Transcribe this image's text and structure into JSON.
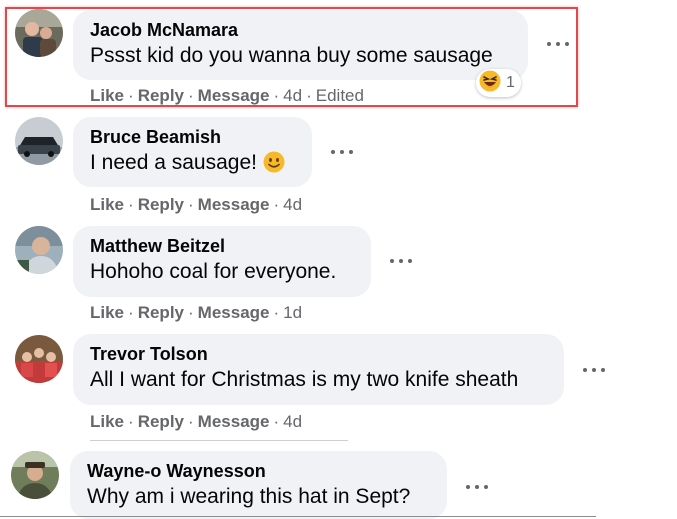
{
  "actions": {
    "like": "Like",
    "reply": "Reply",
    "message": "Message",
    "separator": "·"
  },
  "comments": [
    {
      "author": "Jacob McNamara",
      "text": "Pssst kid do you wanna buy some sausage",
      "age": "4d",
      "edited": "Edited",
      "reaction": {
        "emoji": "laughing-squint",
        "count": "1"
      }
    },
    {
      "author": "Bruce Beamish",
      "text": "I need a sausage!",
      "text_emoji": "slight-smile",
      "age": "4d"
    },
    {
      "author": "Matthew Beitzel",
      "text": "Hohoho coal for everyone.",
      "age": "1d"
    },
    {
      "author": "Trevor Tolson",
      "text": "All I want for Christmas is my two knife sheath",
      "age": "4d"
    },
    {
      "author": "Wayne-o Waynesson",
      "text": "Why am i wearing this hat in Sept?"
    }
  ],
  "colors": {
    "bubble": "#f0f2f5",
    "meta": "#65676b",
    "highlight": "#e2474b",
    "emoji": "#f7b928"
  }
}
